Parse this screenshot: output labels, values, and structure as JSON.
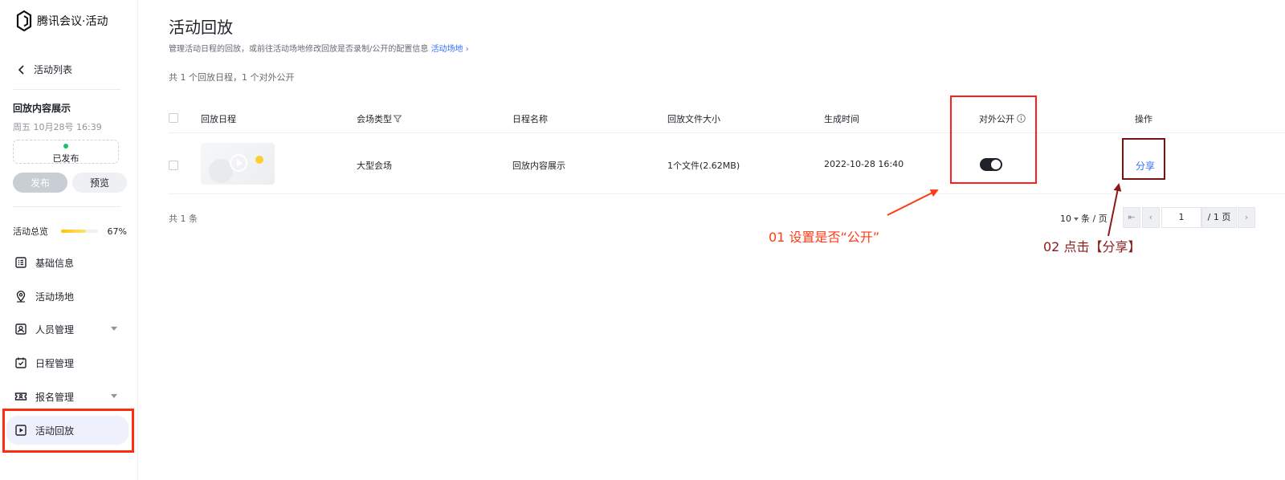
{
  "brand": {
    "name": "腾讯会议·活动"
  },
  "sidebar": {
    "back_label": "活动列表",
    "event_title": "回放内容展示",
    "event_date": "周五  10月28号  16:39",
    "status_label": "已发布",
    "publish_label": "发布",
    "preview_label": "预览",
    "overview_label": "活动总览",
    "overview_progress": 67,
    "overview_pct_label": "67%",
    "items": [
      {
        "label": "基础信息",
        "icon": "list-icon"
      },
      {
        "label": "活动场地",
        "icon": "location-icon"
      },
      {
        "label": "人员管理",
        "icon": "contact-card-icon"
      },
      {
        "label": "日程管理",
        "icon": "calendar-check-icon"
      },
      {
        "label": "报名管理",
        "icon": "ticket-icon"
      },
      {
        "label": "活动回放",
        "icon": "play-square-icon"
      }
    ]
  },
  "main": {
    "title": "活动回放",
    "description": "管理活动日程的回放，或前往活动场地修改回放是否录制/公开的配置信息",
    "description_link": "活动场地 ›",
    "summary": "共 1 个回放日程，1 个对外公开",
    "table": {
      "headers": [
        "回放日程",
        "会场类型",
        "日程名称",
        "回放文件大小",
        "生成时间",
        "对外公开",
        "操作"
      ],
      "rows": [
        {
          "venue_type": "大型会场",
          "schedule_name": "回放内容展示",
          "file_size": "1个文件(2.62MB)",
          "created_at": "2022-10-28 16:40",
          "public": true,
          "action": "分享"
        }
      ]
    },
    "total_label": "共 1 条",
    "pagination": {
      "page_size": "10",
      "page_size_unit": "条 / 页",
      "first": "⇤",
      "prev": "‹",
      "current_page": "1",
      "total_pages": "/ 1 页",
      "next": "›"
    }
  },
  "annotations": {
    "step1": "01 设置是否“公开”",
    "step2": "02 点击【分享】"
  },
  "colors": {
    "accent": "#3370ff",
    "highlight_red": "#ff2d10",
    "highlight_dark": "#7a1010",
    "status_green": "#13c26b"
  }
}
